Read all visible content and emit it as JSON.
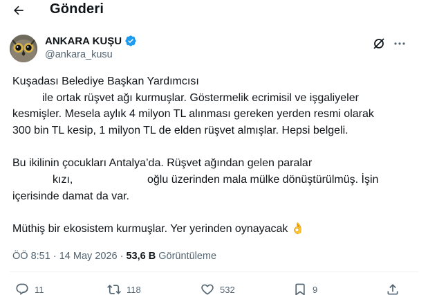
{
  "header": {
    "title": "Gönderi"
  },
  "author": {
    "display_name": "ANKARA KUŞU",
    "handle": "@ankara_kusu"
  },
  "tweet": {
    "lines": [
      "Kuşadası Belediye Başkan Yardımcısı",
      "ile ortak rüşvet ağı kurmuşlar. Göstermelik ecrimisil ve işgaliyeler",
      "kesmişler. Mesela aylık 4 milyon TL alınması gereken yerden resmi olarak",
      "300 bin TL kesip, 1 milyon TL de elden rüşvet almışlar. Hepsi belgeli.",
      "Bu ikilinin çocukları Antalya’da. Rüşvet ağından gelen paralar",
      "kızı,",
      "oğlu üzerinden mala mülke dönüştürülmüş. İşin",
      "içerisinde damat da var.",
      "Müthiş bir ekosistem kurmuşlar. Yer yerinden oynayacak 👌"
    ]
  },
  "meta": {
    "time": "ÖÖ 8:51",
    "separator": "·",
    "date": "14 May 2026",
    "views_count": "53,6 B",
    "views_label": "Görüntüleme"
  },
  "actions": {
    "replies": "11",
    "reposts": "118",
    "likes": "532",
    "bookmarks": "9"
  },
  "colors": {
    "verified": "#1d9bf0",
    "secondary_text": "#536471",
    "primary_text": "#0f1419"
  },
  "icons": [
    "back-arrow-icon",
    "verified-badge-icon",
    "grok-icon",
    "more-icon",
    "reply-icon",
    "repost-icon",
    "like-icon",
    "bookmark-icon",
    "share-icon"
  ]
}
